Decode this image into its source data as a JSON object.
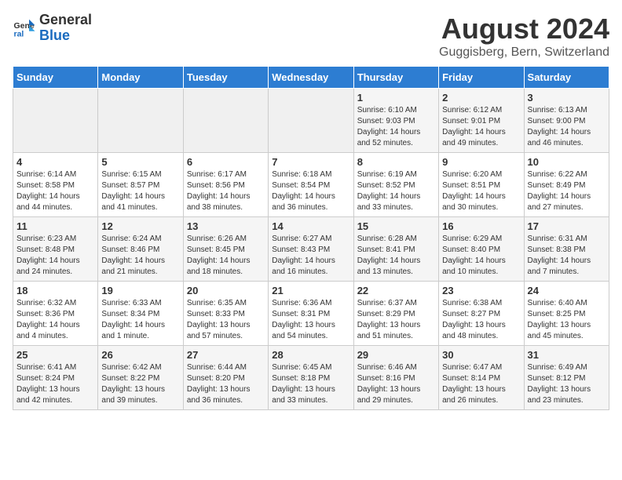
{
  "header": {
    "logo_general": "General",
    "logo_blue": "Blue",
    "title": "August 2024",
    "subtitle": "Guggisberg, Bern, Switzerland"
  },
  "calendar": {
    "days_of_week": [
      "Sunday",
      "Monday",
      "Tuesday",
      "Wednesday",
      "Thursday",
      "Friday",
      "Saturday"
    ],
    "weeks": [
      [
        {
          "day": "",
          "info": ""
        },
        {
          "day": "",
          "info": ""
        },
        {
          "day": "",
          "info": ""
        },
        {
          "day": "",
          "info": ""
        },
        {
          "day": "1",
          "info": "Sunrise: 6:10 AM\nSunset: 9:03 PM\nDaylight: 14 hours\nand 52 minutes."
        },
        {
          "day": "2",
          "info": "Sunrise: 6:12 AM\nSunset: 9:01 PM\nDaylight: 14 hours\nand 49 minutes."
        },
        {
          "day": "3",
          "info": "Sunrise: 6:13 AM\nSunset: 9:00 PM\nDaylight: 14 hours\nand 46 minutes."
        }
      ],
      [
        {
          "day": "4",
          "info": "Sunrise: 6:14 AM\nSunset: 8:58 PM\nDaylight: 14 hours\nand 44 minutes."
        },
        {
          "day": "5",
          "info": "Sunrise: 6:15 AM\nSunset: 8:57 PM\nDaylight: 14 hours\nand 41 minutes."
        },
        {
          "day": "6",
          "info": "Sunrise: 6:17 AM\nSunset: 8:56 PM\nDaylight: 14 hours\nand 38 minutes."
        },
        {
          "day": "7",
          "info": "Sunrise: 6:18 AM\nSunset: 8:54 PM\nDaylight: 14 hours\nand 36 minutes."
        },
        {
          "day": "8",
          "info": "Sunrise: 6:19 AM\nSunset: 8:52 PM\nDaylight: 14 hours\nand 33 minutes."
        },
        {
          "day": "9",
          "info": "Sunrise: 6:20 AM\nSunset: 8:51 PM\nDaylight: 14 hours\nand 30 minutes."
        },
        {
          "day": "10",
          "info": "Sunrise: 6:22 AM\nSunset: 8:49 PM\nDaylight: 14 hours\nand 27 minutes."
        }
      ],
      [
        {
          "day": "11",
          "info": "Sunrise: 6:23 AM\nSunset: 8:48 PM\nDaylight: 14 hours\nand 24 minutes."
        },
        {
          "day": "12",
          "info": "Sunrise: 6:24 AM\nSunset: 8:46 PM\nDaylight: 14 hours\nand 21 minutes."
        },
        {
          "day": "13",
          "info": "Sunrise: 6:26 AM\nSunset: 8:45 PM\nDaylight: 14 hours\nand 18 minutes."
        },
        {
          "day": "14",
          "info": "Sunrise: 6:27 AM\nSunset: 8:43 PM\nDaylight: 14 hours\nand 16 minutes."
        },
        {
          "day": "15",
          "info": "Sunrise: 6:28 AM\nSunset: 8:41 PM\nDaylight: 14 hours\nand 13 minutes."
        },
        {
          "day": "16",
          "info": "Sunrise: 6:29 AM\nSunset: 8:40 PM\nDaylight: 14 hours\nand 10 minutes."
        },
        {
          "day": "17",
          "info": "Sunrise: 6:31 AM\nSunset: 8:38 PM\nDaylight: 14 hours\nand 7 minutes."
        }
      ],
      [
        {
          "day": "18",
          "info": "Sunrise: 6:32 AM\nSunset: 8:36 PM\nDaylight: 14 hours\nand 4 minutes."
        },
        {
          "day": "19",
          "info": "Sunrise: 6:33 AM\nSunset: 8:34 PM\nDaylight: 14 hours\nand 1 minute."
        },
        {
          "day": "20",
          "info": "Sunrise: 6:35 AM\nSunset: 8:33 PM\nDaylight: 13 hours\nand 57 minutes."
        },
        {
          "day": "21",
          "info": "Sunrise: 6:36 AM\nSunset: 8:31 PM\nDaylight: 13 hours\nand 54 minutes."
        },
        {
          "day": "22",
          "info": "Sunrise: 6:37 AM\nSunset: 8:29 PM\nDaylight: 13 hours\nand 51 minutes."
        },
        {
          "day": "23",
          "info": "Sunrise: 6:38 AM\nSunset: 8:27 PM\nDaylight: 13 hours\nand 48 minutes."
        },
        {
          "day": "24",
          "info": "Sunrise: 6:40 AM\nSunset: 8:25 PM\nDaylight: 13 hours\nand 45 minutes."
        }
      ],
      [
        {
          "day": "25",
          "info": "Sunrise: 6:41 AM\nSunset: 8:24 PM\nDaylight: 13 hours\nand 42 minutes."
        },
        {
          "day": "26",
          "info": "Sunrise: 6:42 AM\nSunset: 8:22 PM\nDaylight: 13 hours\nand 39 minutes."
        },
        {
          "day": "27",
          "info": "Sunrise: 6:44 AM\nSunset: 8:20 PM\nDaylight: 13 hours\nand 36 minutes."
        },
        {
          "day": "28",
          "info": "Sunrise: 6:45 AM\nSunset: 8:18 PM\nDaylight: 13 hours\nand 33 minutes."
        },
        {
          "day": "29",
          "info": "Sunrise: 6:46 AM\nSunset: 8:16 PM\nDaylight: 13 hours\nand 29 minutes."
        },
        {
          "day": "30",
          "info": "Sunrise: 6:47 AM\nSunset: 8:14 PM\nDaylight: 13 hours\nand 26 minutes."
        },
        {
          "day": "31",
          "info": "Sunrise: 6:49 AM\nSunset: 8:12 PM\nDaylight: 13 hours\nand 23 minutes."
        }
      ]
    ]
  }
}
